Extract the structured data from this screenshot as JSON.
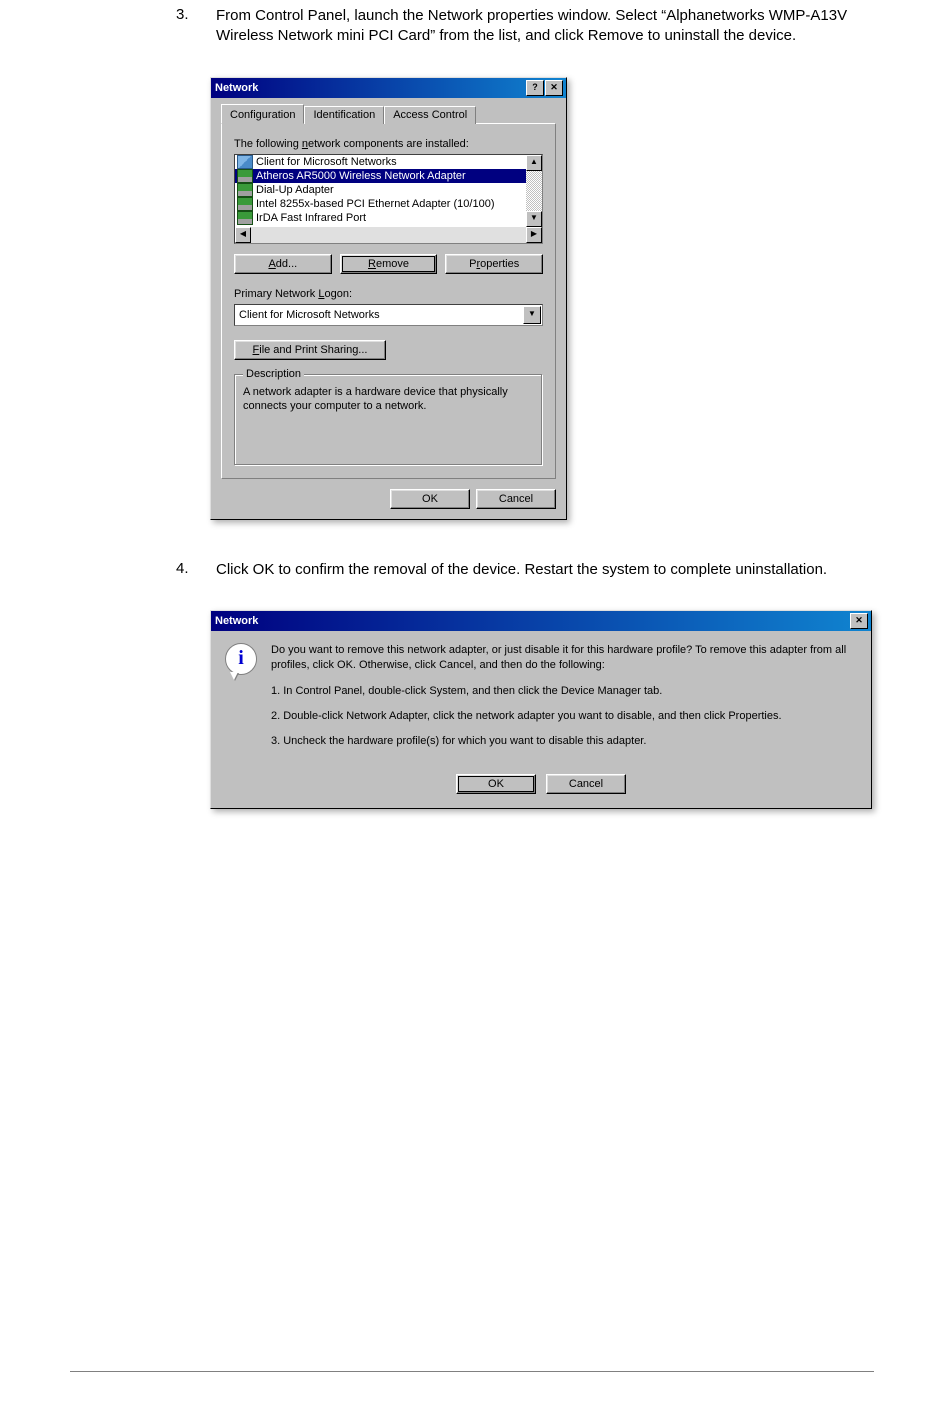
{
  "steps": {
    "s3": {
      "num": "3.",
      "text": "From Control Panel, launch the Network properties window. Select “Alphanetworks WMP-A13V Wireless Network mini PCI Card” from the list, and click Remove to uninstall the device."
    },
    "s4": {
      "num": "4.",
      "text": "Click OK to confirm the removal of the device. Restart the system to complete uninstallation."
    }
  },
  "dlg1": {
    "title": "Network",
    "help_btn": "?",
    "close_btn": "✕",
    "tabs": {
      "configuration": "Configuration",
      "identification": "Identification",
      "access": "Access Control"
    },
    "components_label_pre": "The following ",
    "components_label_u": "n",
    "components_label_post": "etwork components are installed:",
    "list": {
      "i0": "Client for Microsoft Networks",
      "i1": "Atheros AR5000 Wireless Network Adapter",
      "i2": "Dial-Up Adapter",
      "i3": "Intel 8255x-based PCI Ethernet Adapter (10/100)",
      "i4": "IrDA Fast Infrared Port"
    },
    "buttons": {
      "add_u": "A",
      "add_rest": "dd...",
      "remove_u": "R",
      "remove_rest": "emove",
      "properties_pre": "P",
      "properties_u": "r",
      "properties_post": "operties"
    },
    "logon_label_pre": "Primary Network ",
    "logon_label_u": "L",
    "logon_label_post": "ogon:",
    "logon_value": "Client for Microsoft Networks",
    "fps_u": "F",
    "fps_rest": "ile and Print Sharing...",
    "desc_legend": "Description",
    "desc_text": "A network adapter is a hardware device that physically connects your computer to a network.",
    "ok": "OK",
    "cancel": "Cancel",
    "scroll": {
      "up": "▲",
      "down": "▼",
      "left": "◀",
      "right": "▶"
    }
  },
  "dlg2": {
    "title": "Network",
    "close_btn": "✕",
    "p0": "Do you want to remove this network adapter, or just disable it for this hardware profile?  To remove this adapter from all profiles, click OK.  Otherwise, click Cancel, and then do the following:",
    "p1": "1.  In Control Panel, double-click System, and then click the Device Manager tab.",
    "p2": "2.  Double-click Network Adapter, click the network adapter you want to disable, and then click Properties.",
    "p3": "3.  Uncheck the hardware profile(s) for which you want to disable this adapter.",
    "ok": "OK",
    "cancel": "Cancel",
    "info_glyph": "i"
  }
}
